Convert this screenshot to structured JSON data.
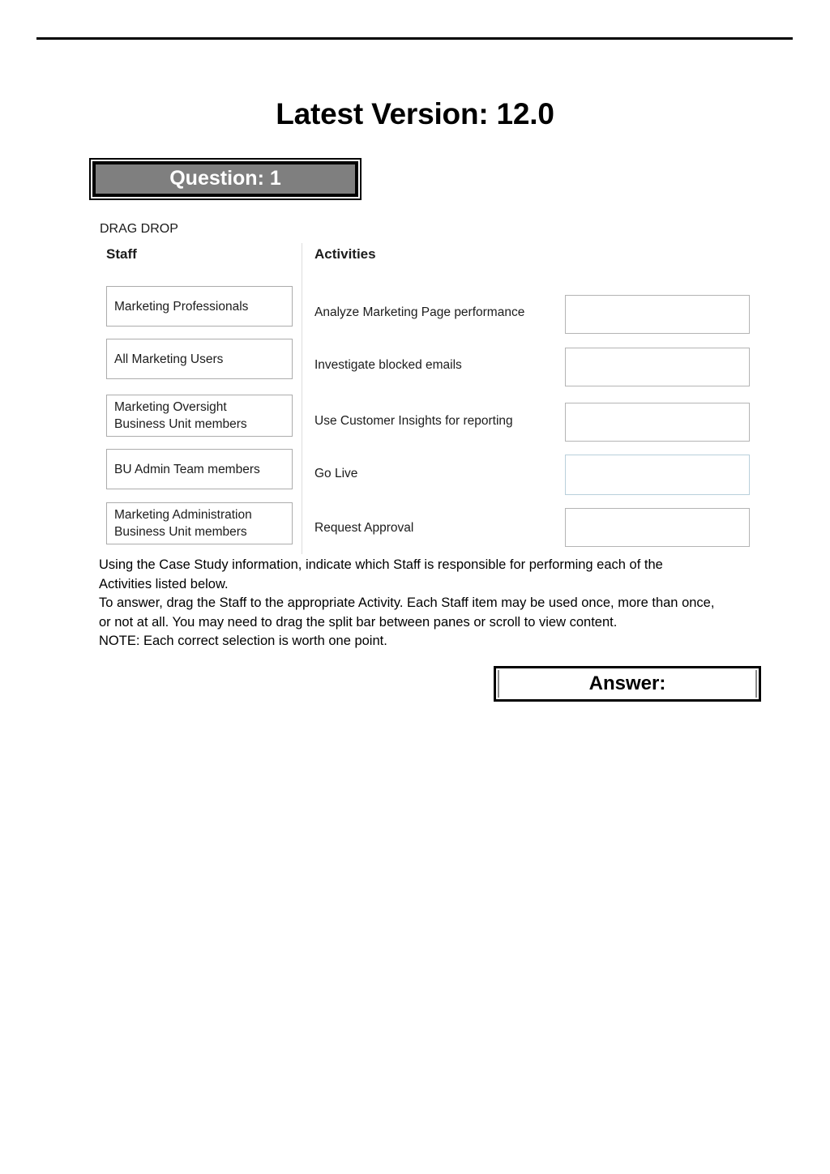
{
  "document": {
    "title": "Latest Version: 12.0",
    "top_rule": true
  },
  "question": {
    "banner_label": "Question: 1",
    "type_label": "DRAG DROP",
    "banner_fill_color": "#7f7f7f",
    "banner_text_color": "#ffffff"
  },
  "exhibit": {
    "staff_column": {
      "header": "Staff",
      "items": [
        {
          "label": "Marketing Professionals"
        },
        {
          "label": "All Marketing Users"
        },
        {
          "label": "Marketing Oversight\nBusiness Unit members"
        },
        {
          "label": "BU Admin Team members"
        },
        {
          "label": "Marketing Administration\nBusiness Unit members"
        }
      ]
    },
    "activities_column": {
      "header": "Activities",
      "items": [
        {
          "label": "Analyze Marketing Page performance",
          "answer": "",
          "highlighted": false
        },
        {
          "label": "Investigate blocked emails",
          "answer": "",
          "highlighted": false
        },
        {
          "label": "Use Customer Insights for reporting",
          "answer": "",
          "highlighted": false
        },
        {
          "label": "Go Live",
          "answer": "",
          "highlighted": true
        },
        {
          "label": "Request Approval",
          "answer": "",
          "highlighted": false
        }
      ]
    }
  },
  "instructions": {
    "line1": "Using the Case Study information, indicate which Staff is responsible for performing each of the",
    "line2": "Activities listed below.",
    "line3": "To answer, drag the Staff to the appropriate Activity. Each Staff item may be used once, more than once,",
    "line4": "or not at all. You may need to drag the split bar between panes or scroll to view content.",
    "line5": "NOTE: Each correct selection is worth one point."
  },
  "answer": {
    "label": "Answer:"
  }
}
